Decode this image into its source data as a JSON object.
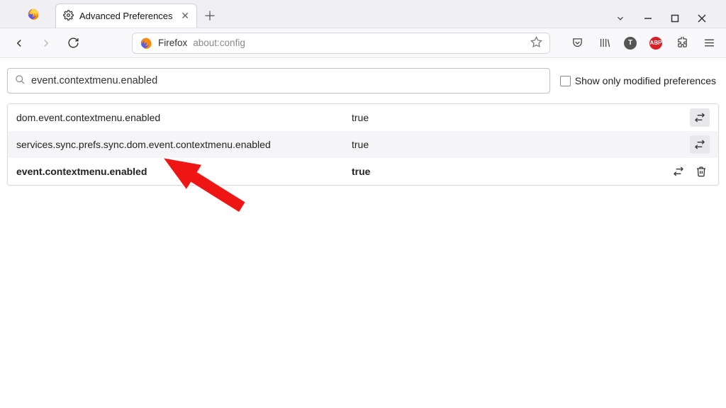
{
  "window": {
    "tab_title": "Advanced Preferences",
    "newtab_tooltip": "+"
  },
  "toolbar": {
    "identity_label": "Firefox",
    "address": "about:config",
    "icons": {
      "pocket": "pocket-icon",
      "library": "library-icon",
      "account": "T",
      "abp": "ABP",
      "ext": "extensions-icon",
      "menu": "menu-icon"
    }
  },
  "config": {
    "search_value": "event.contextmenu.enabled",
    "modified_checkbox_label": "Show only modified preferences",
    "rows": [
      {
        "name": "dom.event.contextmenu.enabled",
        "value": "true",
        "bold": false,
        "deletable": false
      },
      {
        "name": "services.sync.prefs.sync.dom.event.contextmenu.enabled",
        "value": "true",
        "bold": false,
        "deletable": false
      },
      {
        "name": "event.contextmenu.enabled",
        "value": "true",
        "bold": true,
        "deletable": true
      }
    ]
  }
}
